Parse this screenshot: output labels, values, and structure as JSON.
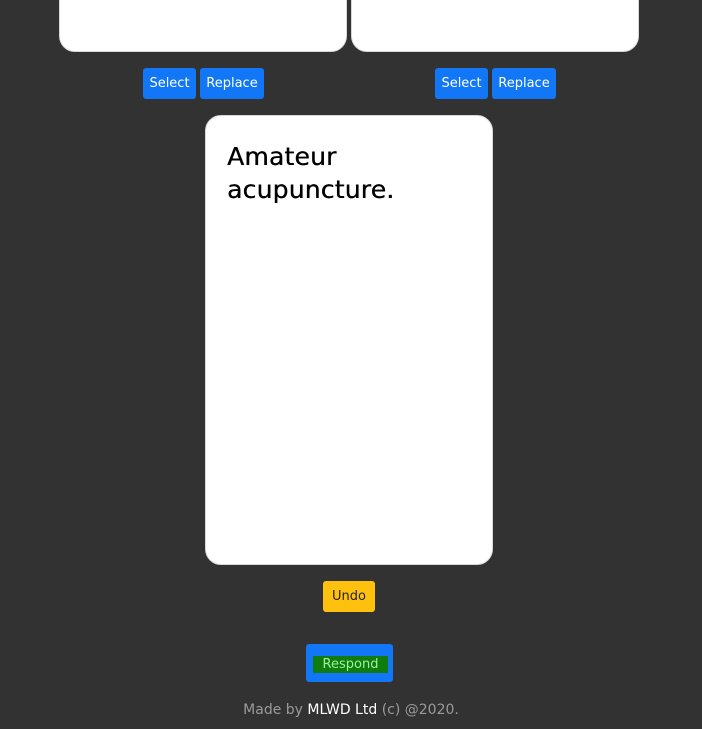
{
  "cards": {
    "left": {
      "text": ""
    },
    "right": {
      "text": ""
    },
    "center": {
      "text": "Amateur acupuncture."
    }
  },
  "buttons": {
    "select_left": "Select",
    "replace_left": "Replace",
    "select_right": "Select",
    "replace_right": "Replace",
    "undo": "Undo",
    "respond": "Respond"
  },
  "footer": {
    "prefix": "Made by",
    "company": "MLWD Ltd",
    "suffix": "(c) @2020."
  },
  "colors": {
    "background": "#323232",
    "primary": "#1177f7",
    "warning": "#ffc10d",
    "respond_fill": "#107c10",
    "respond_text": "#9cf29c"
  }
}
